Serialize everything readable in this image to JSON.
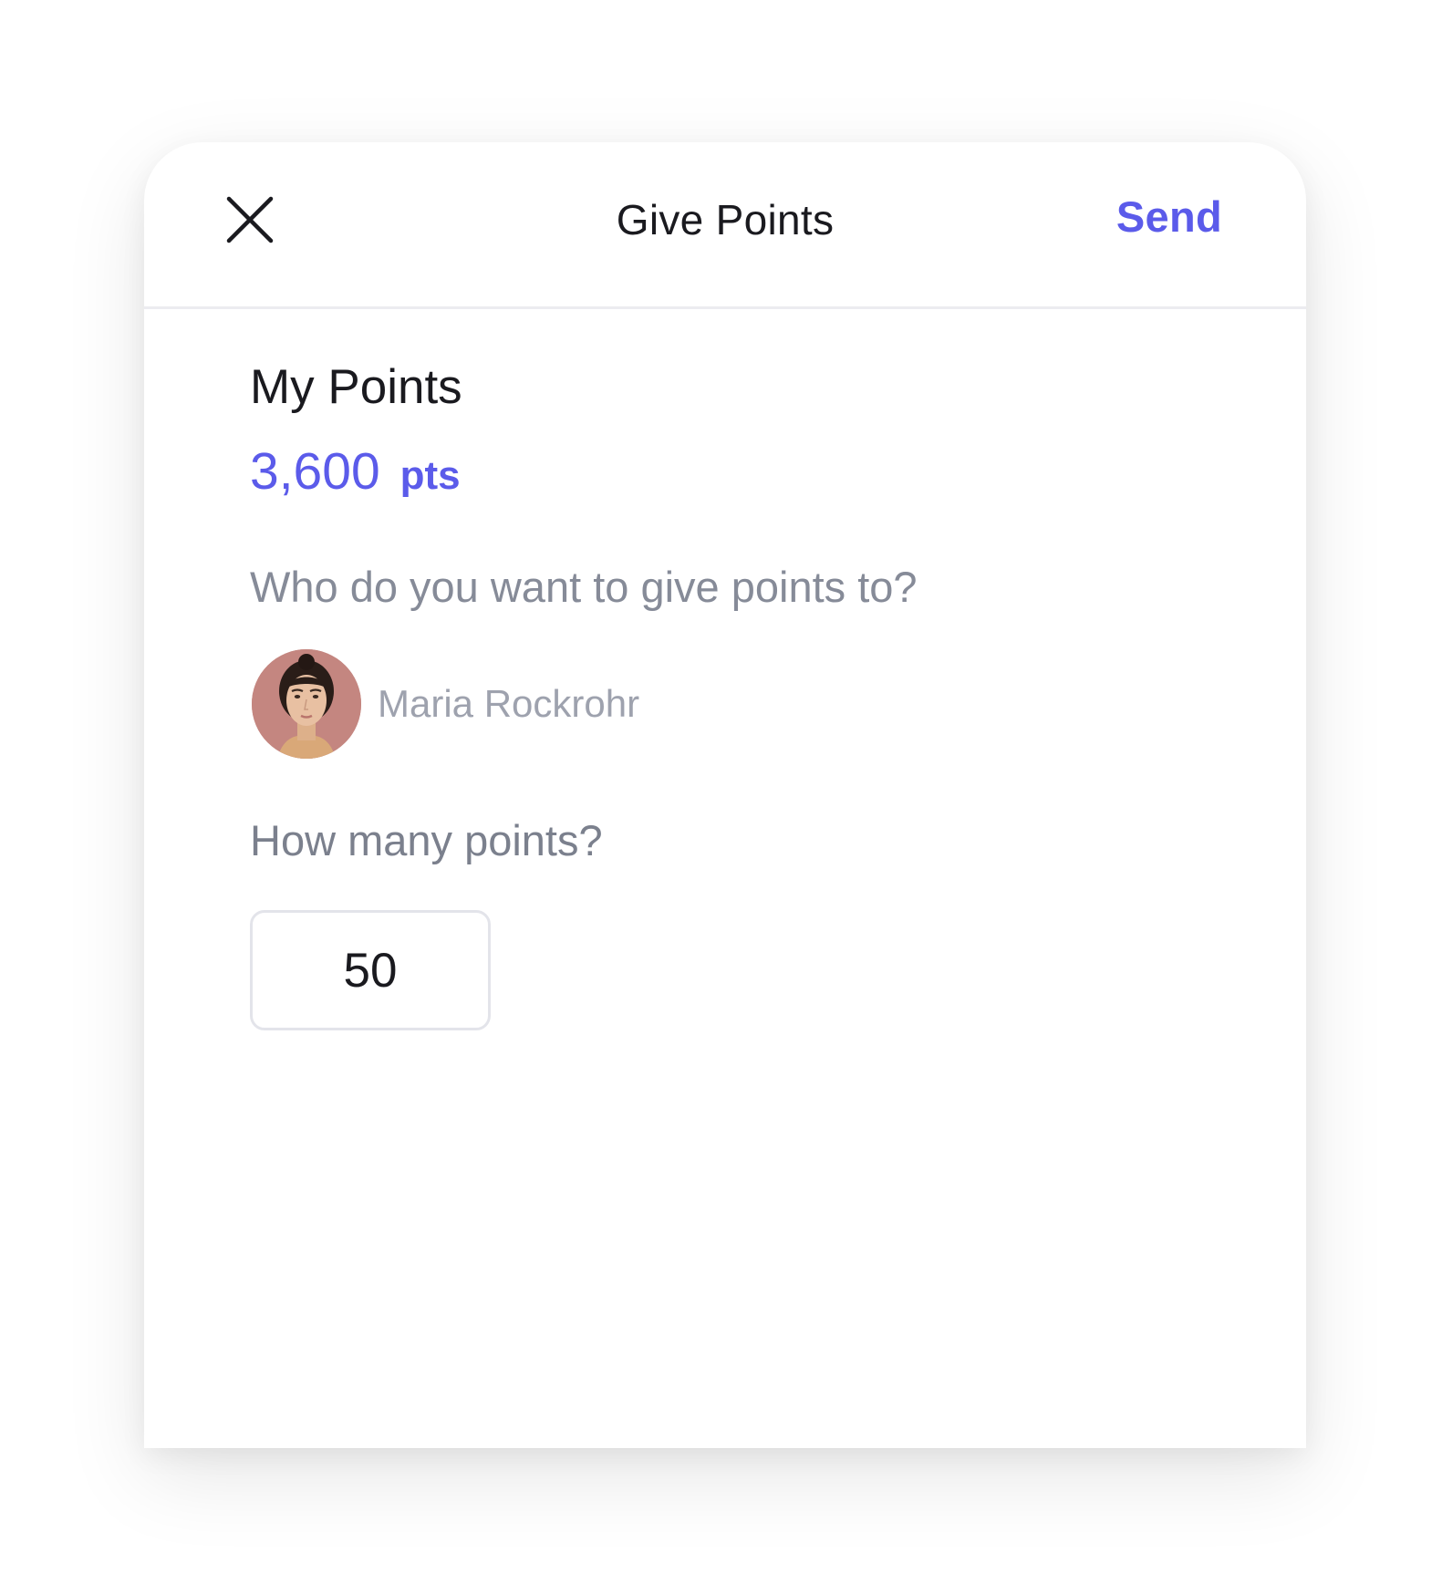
{
  "header": {
    "title": "Give Points",
    "send_label": "Send",
    "close_icon": "close-icon"
  },
  "balance": {
    "label": "My Points",
    "value": "3,600",
    "unit": "pts"
  },
  "recipient_section": {
    "question": "Who do you want to give points to?",
    "recipient_name": "Maria Rockrohr"
  },
  "amount_section": {
    "question": "How many points?",
    "value": "50"
  },
  "colors": {
    "accent": "#5b5bea",
    "text_primary": "#1a1a1f",
    "text_secondary": "#868b98"
  }
}
